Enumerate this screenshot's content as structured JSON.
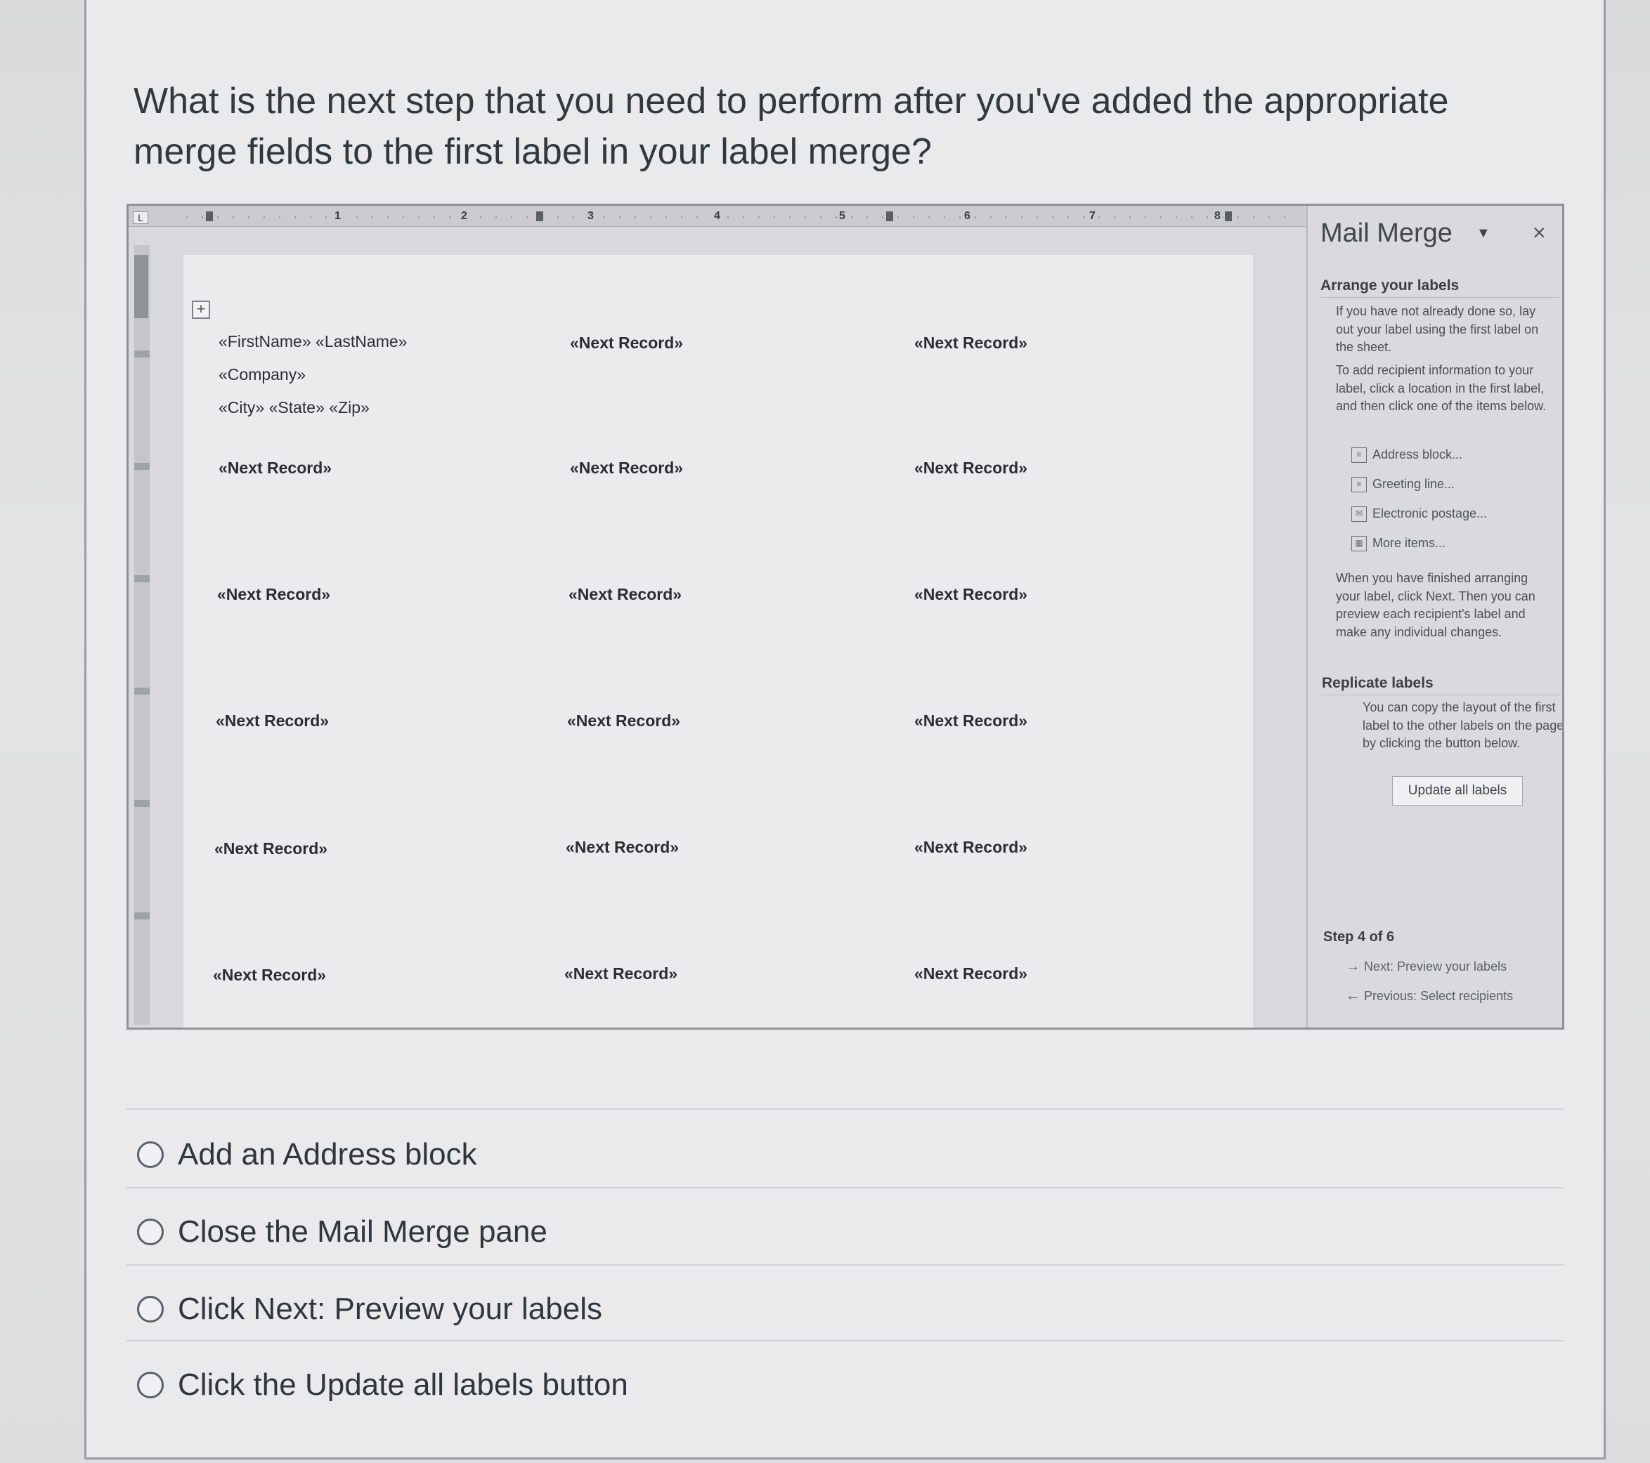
{
  "question": "What is the next step that you need to perform after you've added the appropriate merge fields to the first label in your label merge?",
  "ruler": {
    "corner": "L",
    "numbers": [
      "1",
      "2",
      "3",
      "4",
      "5",
      "6",
      "7",
      "8"
    ]
  },
  "document": {
    "first_label": [
      "«FirstName» «LastName»",
      "«Company»",
      "«City» «State» «Zip»"
    ],
    "next_record": "«Next Record»"
  },
  "pane": {
    "title": "Mail Merge",
    "close": "×",
    "arrange_heading": "Arrange your labels",
    "arrange_text_1": "If you have not already done so, lay out your label using the first label on the sheet.",
    "arrange_text_2": "To add recipient information to your label, click a location in the first label, and then click one of the items below.",
    "items": [
      "Address block...",
      "Greeting line...",
      "Electronic postage...",
      "More items..."
    ],
    "finish_text": "When you have finished arranging your label, click Next. Then you can preview each recipient's label and make any individual changes.",
    "replicate_heading": "Replicate labels",
    "replicate_text": "You can copy the layout of the first label to the other labels on the page by clicking the button below.",
    "update_button": "Update all labels",
    "step": "Step 4 of 6",
    "next_link": "Next: Preview your labels",
    "previous_link": "Previous: Select recipients"
  },
  "answers": [
    "Add an Address block",
    "Close the Mail Merge pane",
    "Click Next: Preview your labels",
    "Click the Update all labels button"
  ]
}
